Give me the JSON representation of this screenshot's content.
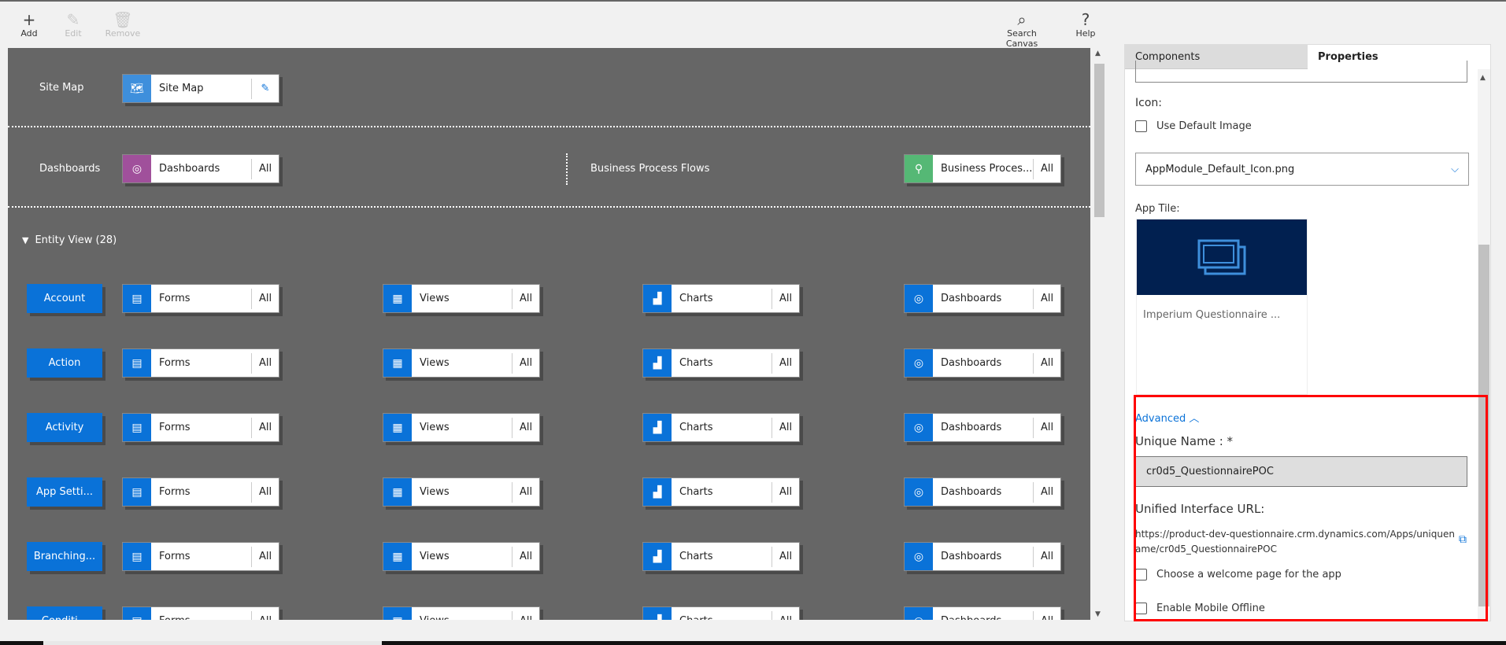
{
  "toolbar": {
    "add": "Add",
    "edit": "Edit",
    "remove": "Remove",
    "search_canvas": "Search Canvas",
    "help": "Help"
  },
  "canvas": {
    "site_map": {
      "label": "Site Map",
      "card_label": "Site Map"
    },
    "dashboards": {
      "label": "Dashboards",
      "card_label": "Dashboards",
      "scope": "All"
    },
    "bpf": {
      "label": "Business Process Flows",
      "card_label": "Business Proces...",
      "scope": "All"
    },
    "entity_view": {
      "title": "Entity View (28)"
    },
    "card_types": [
      {
        "label": "Forms",
        "icon": "form-icon",
        "scope": "All"
      },
      {
        "label": "Views",
        "icon": "grid-icon",
        "scope": "All"
      },
      {
        "label": "Charts",
        "icon": "chart-icon",
        "scope": "All"
      },
      {
        "label": "Dashboards",
        "icon": "dashboard-icon",
        "scope": "All"
      }
    ],
    "entities": [
      "Account",
      "Action",
      "Activity",
      "App Setti...",
      "Branching...",
      "Conditi..."
    ]
  },
  "colors": {
    "entity_blue": "#0a72d8",
    "dashboard_purple": "#a0509b",
    "bpf_green": "#55b875",
    "sitemap_blue": "#3e8fdc",
    "tile_navy": "#012050"
  },
  "panel": {
    "tabs": {
      "components": "Components",
      "properties": "Properties"
    },
    "icon_label": "Icon:",
    "use_default_image": "Use Default Image",
    "icon_select": "AppModule_Default_Icon.png",
    "app_tile_label": "App Tile:",
    "app_tile_name": "Imperium Questionnaire ...",
    "advanced": "Advanced",
    "unique_name_label": "Unique Name : *",
    "unique_name_value": "cr0d5_QuestionnairePOC",
    "url_label": "Unified Interface URL:",
    "url": "https://product-dev-questionnaire.crm.dynamics.com/Apps/uniquename/cr0d5_QuestionnairePOC",
    "welcome_page": "Choose a welcome page for the app",
    "mobile_offline": "Enable Mobile Offline"
  }
}
